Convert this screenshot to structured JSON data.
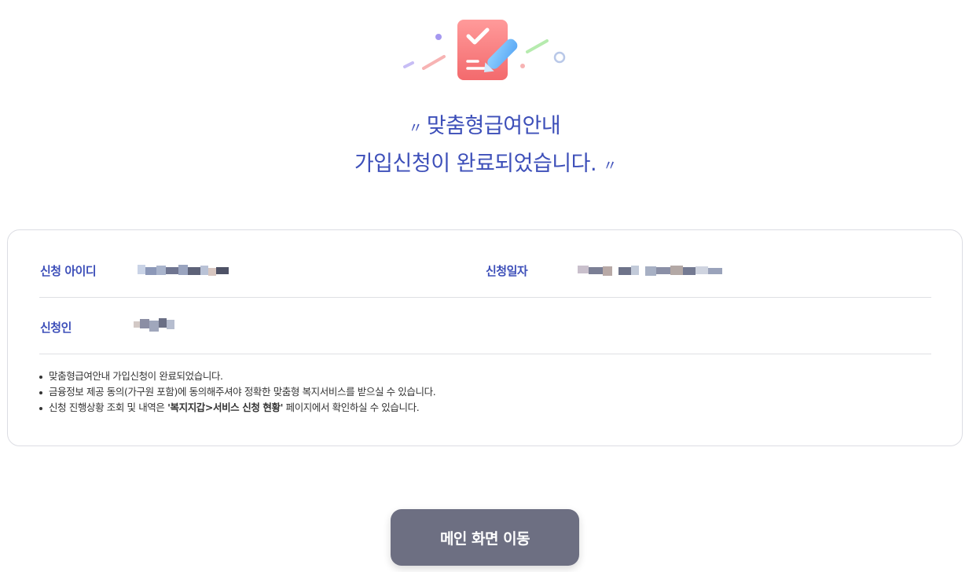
{
  "headline": {
    "open_quote": "〃",
    "line1": "맞춤형급여안내",
    "line2": "가입신청이 완료되었습니다.",
    "close_quote": "〃"
  },
  "hero_icon": "checklist-pencil-icon",
  "colors": {
    "accent": "#3d4fb9",
    "button": "#6d6f82",
    "icon_bg": "#f4787a"
  },
  "info": {
    "id_label": "신청 아이디",
    "date_label": "신청일자",
    "applicant_label": "신청인"
  },
  "notes": {
    "item1": "맞춤형급여안내 가입신청이 완료되었습니다.",
    "item2": "금융정보 제공 동의(가구원 포함)에 동의해주셔야 정확한 맞춤형 복지서비스를 받으실 수 있습니다.",
    "item3_before": "신청 진행상황 조회 및 내역은 ",
    "item3_bold": "'복지지갑>서비스 신청 현황'",
    "item3_after": " 페이지에서 확인하실 수 있습니다."
  },
  "button": {
    "label": "메인 화면 이동"
  }
}
